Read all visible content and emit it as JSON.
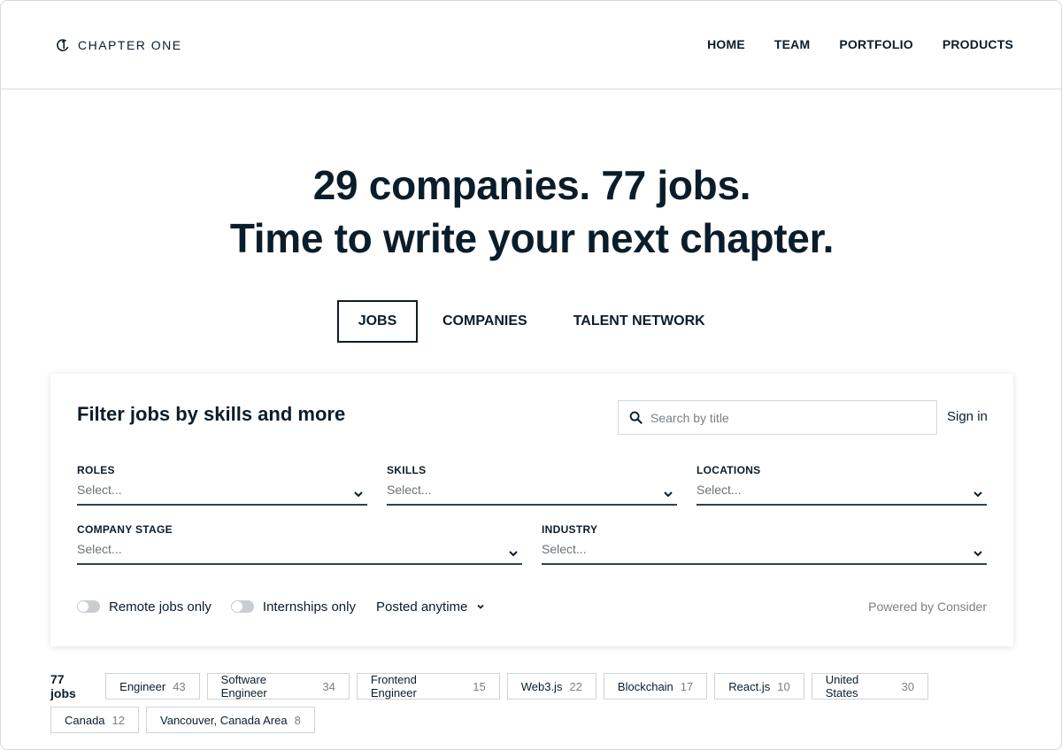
{
  "header": {
    "logo_text": "CHAPTER ONE",
    "nav": [
      "HOME",
      "TEAM",
      "PORTFOLIO",
      "PRODUCTS"
    ]
  },
  "hero": {
    "line1": "29 companies. 77 jobs.",
    "line2": "Time to write your next chapter."
  },
  "tabs": [
    {
      "label": "JOBS",
      "active": true
    },
    {
      "label": "COMPANIES",
      "active": false
    },
    {
      "label": "TALENT NETWORK",
      "active": false
    }
  ],
  "filter": {
    "title": "Filter jobs by skills and more",
    "search_placeholder": "Search by title",
    "signin_label": "Sign in",
    "fields": [
      {
        "label": "ROLES",
        "value": "Select..."
      },
      {
        "label": "SKILLS",
        "value": "Select..."
      },
      {
        "label": "LOCATIONS",
        "value": "Select..."
      },
      {
        "label": "COMPANY STAGE",
        "value": "Select..."
      },
      {
        "label": "INDUSTRY",
        "value": "Select..."
      }
    ],
    "remote_label": "Remote jobs only",
    "internships_label": "Internships only",
    "posted_label": "Posted anytime",
    "powered_by": "Powered by Consider"
  },
  "results": {
    "count_label": "77 jobs",
    "chips": [
      {
        "label": "Engineer",
        "count": "43"
      },
      {
        "label": "Software Engineer",
        "count": "34"
      },
      {
        "label": "Frontend Engineer",
        "count": "15"
      },
      {
        "label": "Web3.js",
        "count": "22"
      },
      {
        "label": "Blockchain",
        "count": "17"
      },
      {
        "label": "React.js",
        "count": "10"
      },
      {
        "label": "United States",
        "count": "30"
      },
      {
        "label": "Canada",
        "count": "12"
      },
      {
        "label": "Vancouver, Canada Area",
        "count": "8"
      }
    ]
  },
  "colors": {
    "text": "#0b1d2a",
    "muted": "#7a8086",
    "border": "#cfd3d6"
  }
}
